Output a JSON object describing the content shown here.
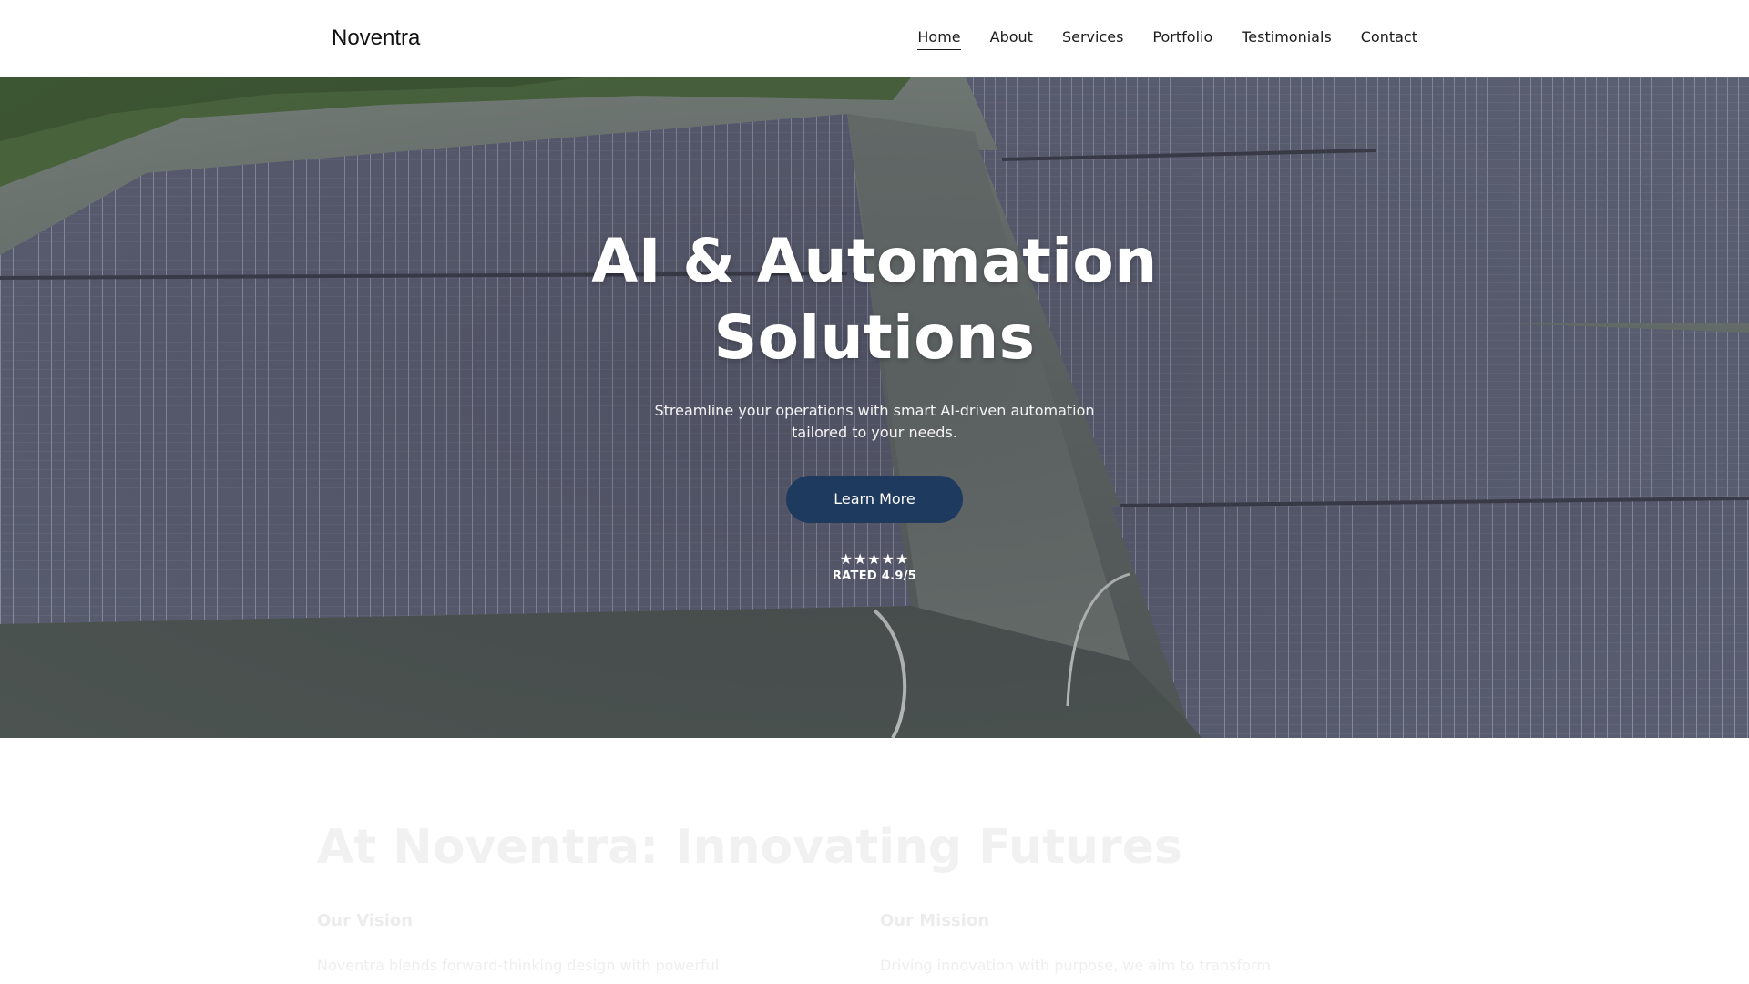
{
  "header": {
    "brand": "Noventra",
    "nav": [
      {
        "label": "Home",
        "active": true
      },
      {
        "label": "About",
        "active": false
      },
      {
        "label": "Services",
        "active": false
      },
      {
        "label": "Portfolio",
        "active": false
      },
      {
        "label": "Testimonials",
        "active": false
      },
      {
        "label": "Contact",
        "active": false
      }
    ]
  },
  "hero": {
    "title_line1": "AI & Automation",
    "title_line2": "Solutions",
    "subtitle": "Streamline your operations with smart AI-driven automation tailored to your needs.",
    "cta_label": "Learn More",
    "stars": "★★★★★",
    "rating": 4.9,
    "rating_label": "RATED 4.9/5",
    "background": "aerial-floating-solar-panels"
  },
  "about": {
    "title": "At Noventra: Innovating Futures",
    "vision_heading": "Our Vision",
    "vision_text": "Noventra blends forward-thinking design with powerful",
    "mission_heading": "Our Mission",
    "mission_text": "Driving innovation with purpose, we aim to transform"
  },
  "colors": {
    "cta": "#1f3a5f",
    "text_dark": "#111111",
    "hero_text": "#ffffff"
  }
}
